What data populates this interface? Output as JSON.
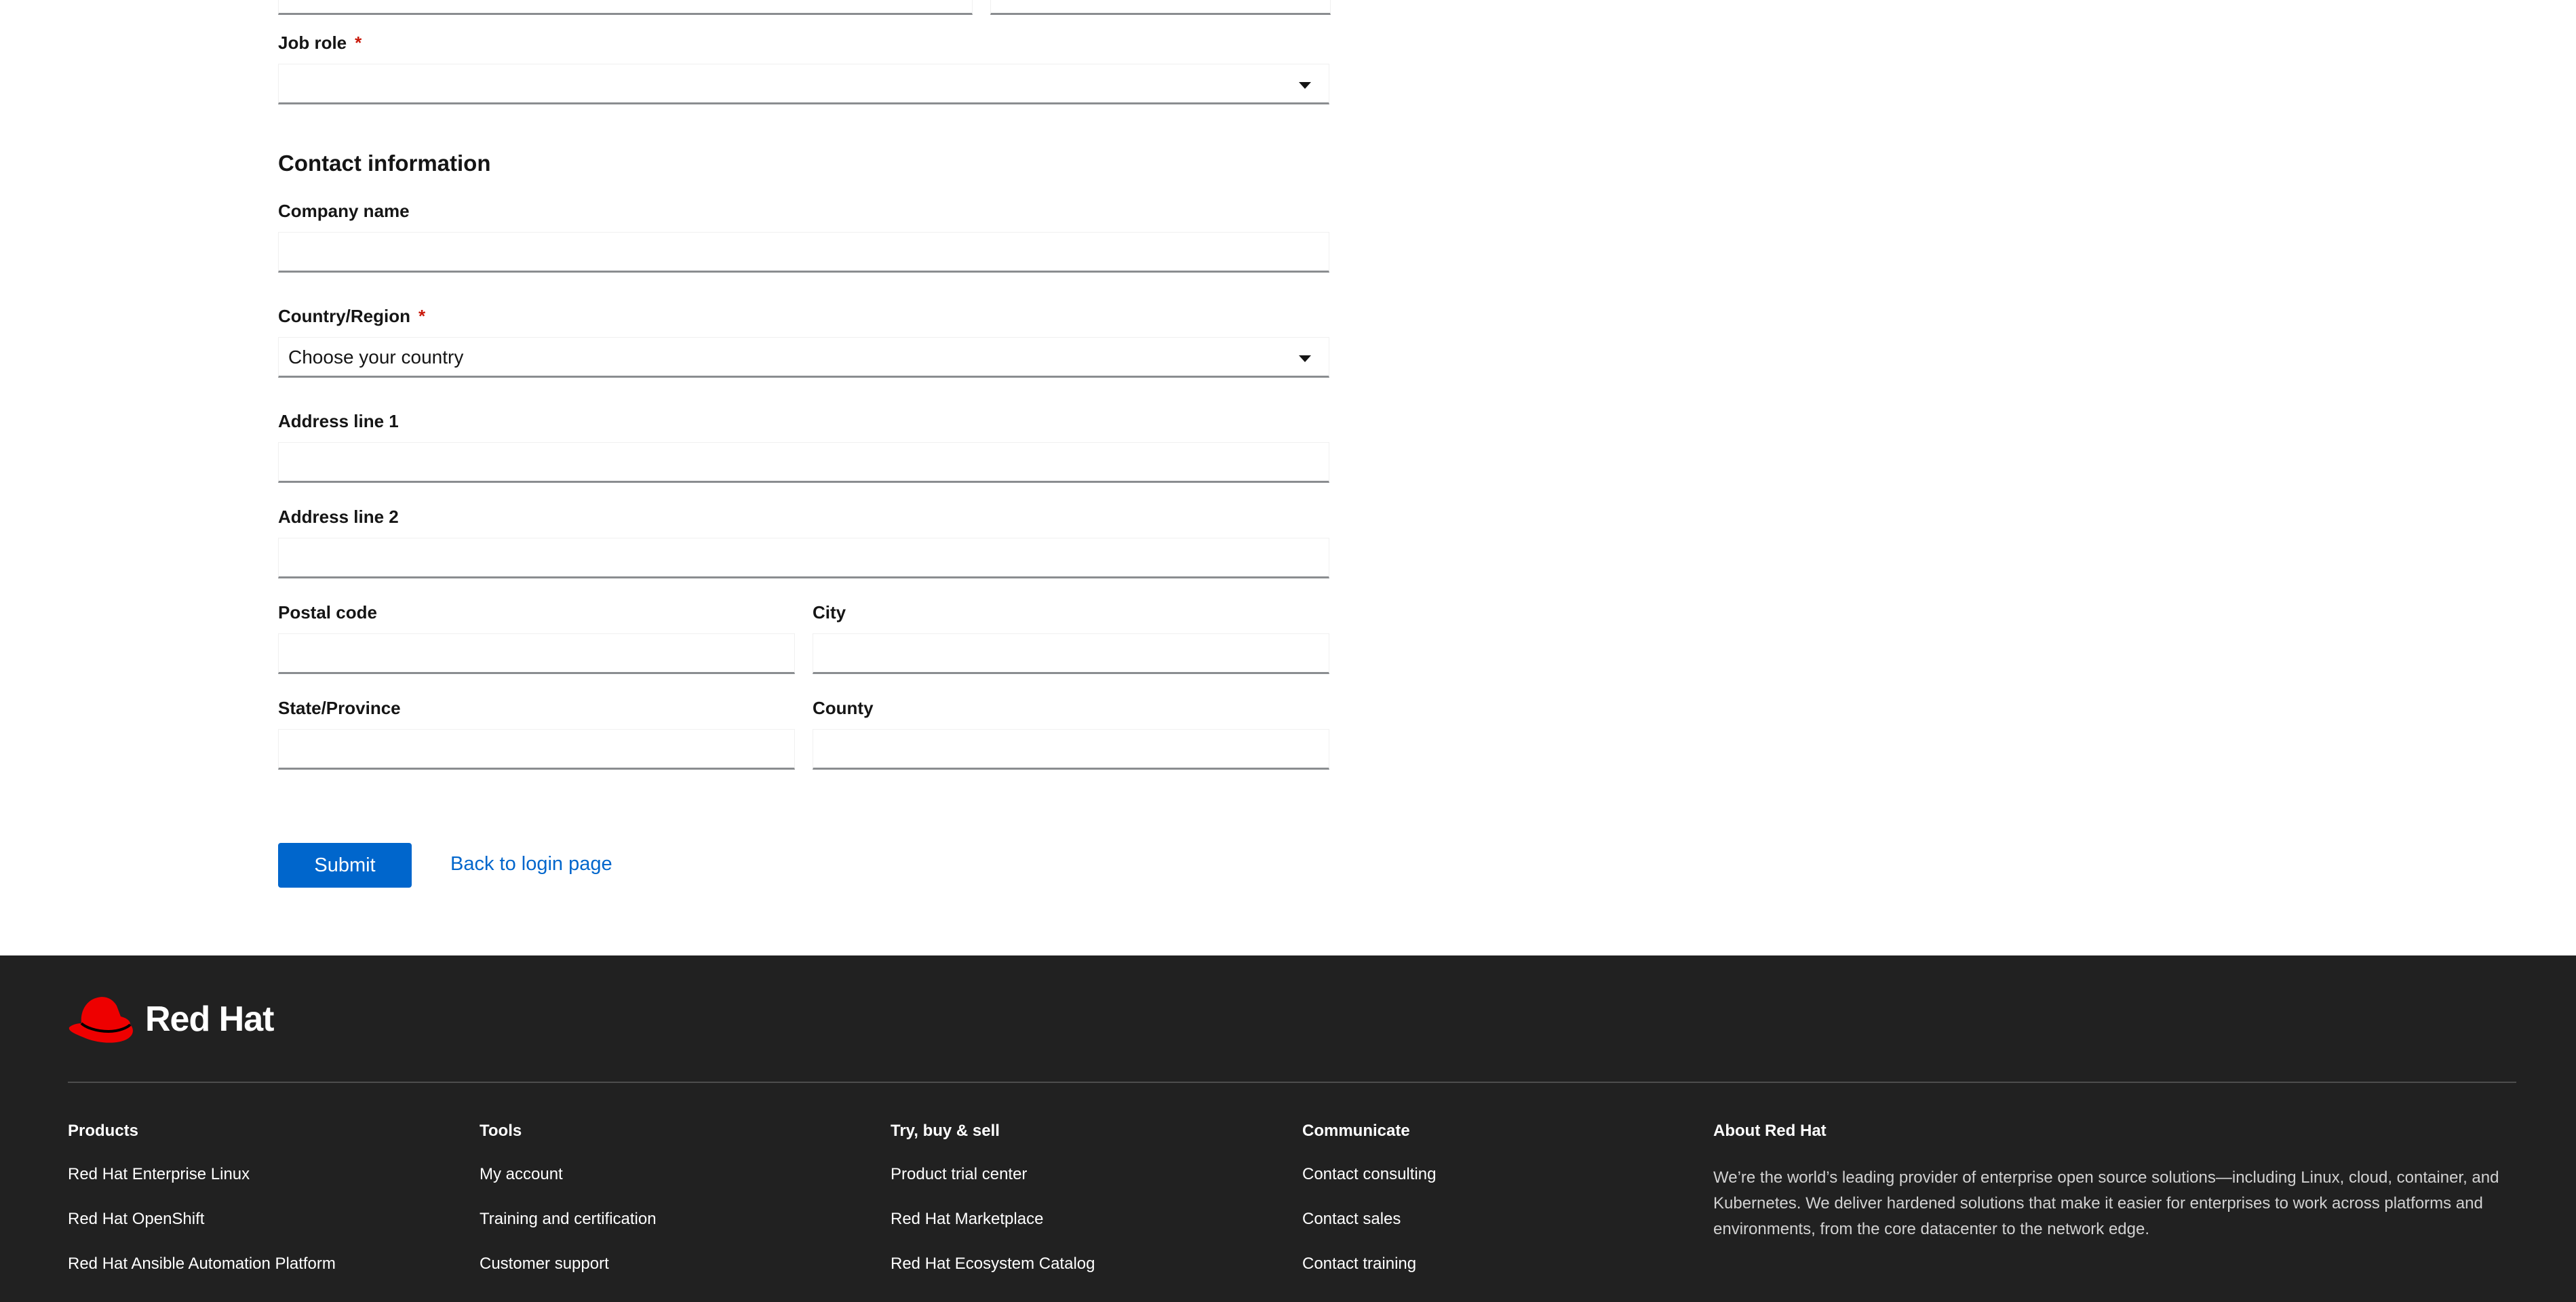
{
  "form": {
    "job_role": {
      "label": "Job role",
      "required_mark": "*",
      "value": ""
    },
    "contact_section_title": "Contact information",
    "company_name": {
      "label": "Company name",
      "value": ""
    },
    "country": {
      "label": "Country/Region",
      "required_mark": "*",
      "value": "Choose your country"
    },
    "address1": {
      "label": "Address line 1",
      "value": ""
    },
    "address2": {
      "label": "Address line 2",
      "value": ""
    },
    "postal_code": {
      "label": "Postal code",
      "value": ""
    },
    "city": {
      "label": "City",
      "value": ""
    },
    "state": {
      "label": "State/Province",
      "value": ""
    },
    "county": {
      "label": "County",
      "value": ""
    },
    "submit_label": "Submit",
    "back_link_label": "Back to login page"
  },
  "footer": {
    "brand": "Red Hat",
    "columns": [
      {
        "title": "Products",
        "links": [
          "Red Hat Enterprise Linux",
          "Red Hat OpenShift",
          "Red Hat Ansible Automation Platform"
        ]
      },
      {
        "title": "Tools",
        "links": [
          "My account",
          "Training and certification",
          "Customer support"
        ]
      },
      {
        "title": "Try, buy & sell",
        "links": [
          "Product trial center",
          "Red Hat Marketplace",
          "Red Hat Ecosystem Catalog"
        ]
      },
      {
        "title": "Communicate",
        "links": [
          "Contact consulting",
          "Contact sales",
          "Contact training"
        ]
      }
    ],
    "about": {
      "title": "About Red Hat",
      "text": "We’re the world’s leading provider of enterprise open source solutions—including Linux, cloud, container, and Kubernetes. We deliver hardened solutions that make it easier for enterprises to work across platforms and environments, from the core datacenter to the network edge."
    }
  },
  "colors": {
    "primary": "#0066cc",
    "required": "#c9190b",
    "footer_bg": "#212121",
    "brand_red": "#ee0000"
  }
}
